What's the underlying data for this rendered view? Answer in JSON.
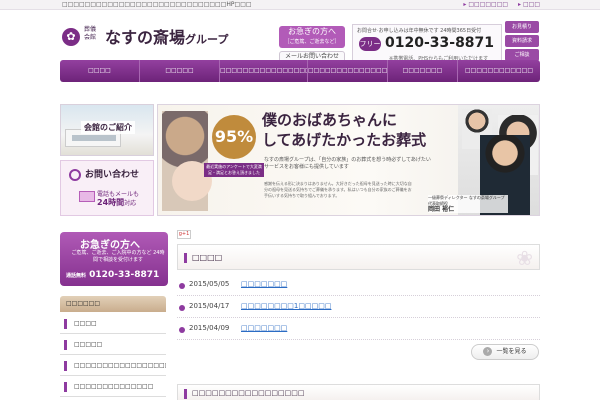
{
  "topbar": {
    "tagline": "□□□□□□□□□□□□□□□□□□□□□□□□□□□□□HP□□□",
    "links": [
      "□□□□□□□",
      "□□□"
    ]
  },
  "header": {
    "logo_mark": "✿",
    "logo_sub": "葬儀 会館",
    "logo_main": "なすの斎場",
    "logo_suffix": "グループ",
    "urgent_label": "お急ぎの方へ",
    "urgent_sub": "［ご危篤、ご逝去など］",
    "mail_label": "メールお問い合わせ",
    "tel_hours": "お問合せ·お申し込みは年中無休です 24時間365日受付",
    "free_icon_label": "フリー",
    "tel_number": "0120-33-8871",
    "tel_note": "※携帯電話、PHSからもご利用いただけます",
    "side_buttons": [
      "お見積り",
      "資料請求",
      "ご相談"
    ]
  },
  "gnav": {
    "items": [
      "□□□□",
      "□□□□□",
      "□□□□□□□□□□□□□□□□□□□□",
      "□□□□□□□□□□□□□□",
      "□□□□□□□",
      "□□□□□□□□□□□□"
    ]
  },
  "sidebar_cards": {
    "hall_label": "会館のご紹介",
    "inquiry_label": "お問い合わせ",
    "inquiry_sub_line1": "電話もメールも",
    "inquiry_sub_line2_bold": "24時間",
    "inquiry_sub_line2_tail": "対応"
  },
  "hero": {
    "badge": "95%",
    "badge_sub": "最近実施のアンケートで大変満足・満足とお答え頂きました",
    "title_line1": "僕のおばあちゃんに",
    "title_line2": "してあげたかったお葬式",
    "copy": "なすの斎場グループは、「自分の家族」のお葬式を想う時必ずしてあげたいサービスをお客様にも提供しています",
    "copy2": "感謝を伝える形に決まりはありません。大好きだった祖母を見送った時に大切な自分の祖母を見送る気持ちでご葬儀を承ります。私はいつも自分の家族のご葬儀をお手伝いする気持ちで取り組んでおります。",
    "director_role": "一級葬祭ディレクター なすの斎場グループ代表取締役",
    "director_name": "岡田 裕仁"
  },
  "urgent_card": {
    "title": "お急ぎの方へ",
    "desc": "ご危篤、ご逝去、ご入院中の方など 24時間で相談を受付けます",
    "tel_prefix": "通話無料",
    "tel_number": "0120-33-8871"
  },
  "side_menu": {
    "head": "□□□□□□",
    "items": [
      "□□□□",
      "□□□□□",
      "□□□□□□□□□□□□□□□□□□",
      "□□□□□□□□□□□□□□"
    ]
  },
  "news": {
    "gplus": "g+1",
    "heading": "□□□□",
    "rows": [
      {
        "date": "2015/05/05",
        "link": "□□□□□□□"
      },
      {
        "date": "2015/04/17",
        "link": "□□□□□□□□1□□□□□"
      },
      {
        "date": "2015/04/09",
        "link": "□□□□□□□"
      }
    ],
    "more_label": "一覧を見る"
  },
  "bottom": {
    "heading": "□□□□□□□□□□□□□□□□□"
  }
}
